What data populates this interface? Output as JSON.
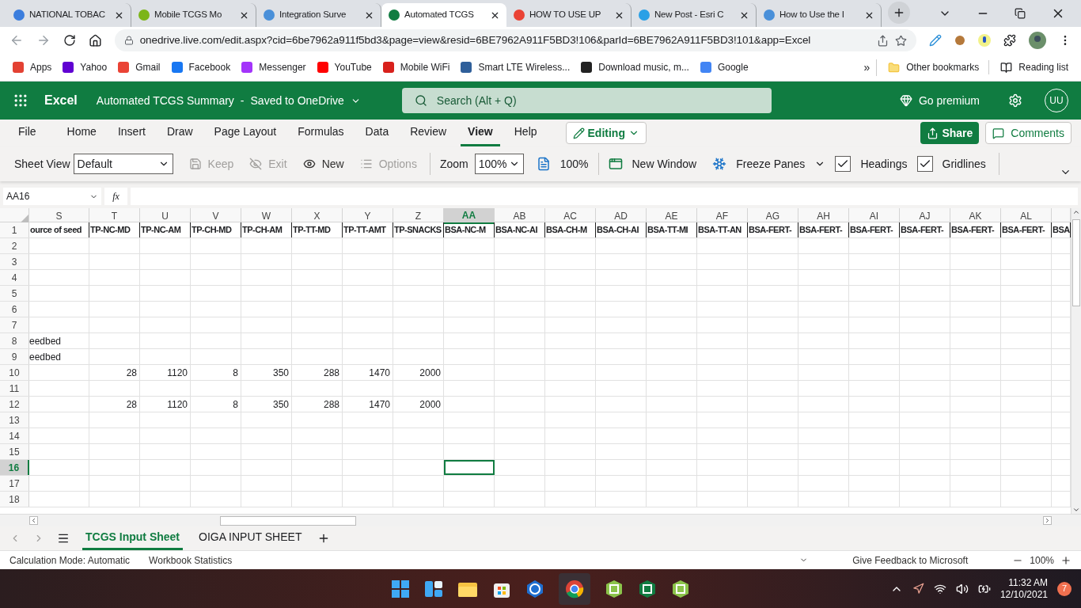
{
  "browser": {
    "tabs": [
      {
        "title": "NATIONAL TOBAC",
        "selected": false
      },
      {
        "title": "Mobile TCGS Mo",
        "selected": false
      },
      {
        "title": "Integration Surve",
        "selected": false
      },
      {
        "title": "Automated TCGS",
        "selected": true
      },
      {
        "title": "HOW TO USE UP",
        "selected": false
      },
      {
        "title": "New Post - Esri C",
        "selected": false
      },
      {
        "title": "How to Use the I",
        "selected": false
      }
    ],
    "url": "onedrive.live.com/edit.aspx?cid=6be7962a911f5bd3&page=view&resid=6BE7962A911F5BD3!106&parId=6BE7962A911F5BD3!101&app=Excel",
    "bookmarks": [
      "Apps",
      "Yahoo",
      "Gmail",
      "Facebook",
      "Messenger",
      "YouTube",
      "Mobile WiFi",
      "Smart LTE Wireless...",
      "Download music, m...",
      "Google"
    ],
    "more": "»",
    "other_bookmarks": "Other bookmarks",
    "reading_list": "Reading list"
  },
  "excel": {
    "app": "Excel",
    "file": "Automated TCGS Summary",
    "dash": "-",
    "saved": "Saved to OneDrive",
    "search_placeholder": "Search (Alt + Q)",
    "premium": "Go premium",
    "avatar": "UU"
  },
  "ribbon": {
    "tabs": [
      {
        "label": "File",
        "selected": false
      },
      {
        "label": "Home",
        "selected": false
      },
      {
        "label": "Insert",
        "selected": false
      },
      {
        "label": "Draw",
        "selected": false
      },
      {
        "label": "Page Layout",
        "selected": false
      },
      {
        "label": "Formulas",
        "selected": false
      },
      {
        "label": "Data",
        "selected": false
      },
      {
        "label": "Review",
        "selected": false
      },
      {
        "label": "View",
        "selected": true
      },
      {
        "label": "Help",
        "selected": false
      }
    ],
    "mode": "Editing",
    "share": "Share",
    "comments": "Comments",
    "sheet_view_label": "Sheet View",
    "sheet_view": "Default",
    "commands": [
      {
        "label": "Keep",
        "disabled": true
      },
      {
        "label": "Exit",
        "disabled": true
      },
      {
        "label": "New",
        "disabled": false
      },
      {
        "label": "Options",
        "disabled": true
      }
    ],
    "zoom_label": "Zoom",
    "zoom": "100%",
    "zoom_100": "100%",
    "new_window": "New Window",
    "freeze_panes": "Freeze Panes",
    "checks": [
      {
        "label": "Headings",
        "checked": true
      },
      {
        "label": "Gridlines",
        "checked": true
      }
    ]
  },
  "formula_bar": {
    "name_box": "AA16",
    "fx": "fx"
  },
  "grid": {
    "columns": [
      {
        "label": "S",
        "selected": false
      },
      {
        "label": "T",
        "selected": false
      },
      {
        "label": "U",
        "selected": false
      },
      {
        "label": "V",
        "selected": false
      },
      {
        "label": "W",
        "selected": false
      },
      {
        "label": "X",
        "selected": false
      },
      {
        "label": "Y",
        "selected": false
      },
      {
        "label": "Z",
        "selected": false
      },
      {
        "label": "AA",
        "selected": true
      },
      {
        "label": "AB",
        "selected": false
      },
      {
        "label": "AC",
        "selected": false
      },
      {
        "label": "AD",
        "selected": false
      },
      {
        "label": "AE",
        "selected": false
      },
      {
        "label": "AF",
        "selected": false
      },
      {
        "label": "AG",
        "selected": false
      },
      {
        "label": "AH",
        "selected": false
      },
      {
        "label": "AI",
        "selected": false
      },
      {
        "label": "AJ",
        "selected": false
      },
      {
        "label": "AK",
        "selected": false
      },
      {
        "label": "AL",
        "selected": false
      }
    ],
    "rows": [
      {
        "label": "1",
        "selected": false,
        "kind": "header",
        "cells": [
          "ource of seed",
          "TP-NC-MD",
          "TP-NC-AM",
          "TP-CH-MD",
          "TP-CH-AM",
          "TP-TT-MD",
          "TP-TT-AMT",
          "TP-SNACKS",
          "BSA-NC-M",
          "BSA-NC-AI",
          "BSA-CH-M",
          "BSA-CH-AI",
          "BSA-TT-MI",
          "BSA-TT-AN",
          "BSA-FERT-",
          "BSA-FERT-",
          "BSA-FERT-",
          "BSA-FERT-",
          "BSA-FERT-",
          "BSA-FERT-",
          "BSA"
        ]
      },
      {
        "label": "2",
        "selected": false
      },
      {
        "label": "3",
        "selected": false
      },
      {
        "label": "4",
        "selected": false
      },
      {
        "label": "5",
        "selected": false
      },
      {
        "label": "6",
        "selected": false
      },
      {
        "label": "7",
        "selected": false
      },
      {
        "label": "8",
        "selected": false,
        "kind": "text",
        "cells": [
          "eedbed"
        ]
      },
      {
        "label": "9",
        "selected": false,
        "kind": "text",
        "cells": [
          "eedbed"
        ]
      },
      {
        "label": "10",
        "selected": false,
        "kind": "numbers",
        "cells": [
          null,
          "28",
          "1120",
          "8",
          "350",
          "288",
          "1470",
          "2000"
        ]
      },
      {
        "label": "11",
        "selected": false
      },
      {
        "label": "12",
        "selected": false,
        "kind": "numbers",
        "cells": [
          null,
          "28",
          "1120",
          "8",
          "350",
          "288",
          "1470",
          "2000"
        ]
      },
      {
        "label": "13",
        "selected": false
      },
      {
        "label": "14",
        "selected": false
      },
      {
        "label": "15",
        "selected": false
      },
      {
        "label": "16",
        "selected": true
      },
      {
        "label": "17",
        "selected": false
      },
      {
        "label": "18",
        "selected": false
      }
    ]
  },
  "sheets": [
    {
      "label": "TCGS Input Sheet",
      "selected": true
    },
    {
      "label": "OIGA INPUT SHEET",
      "selected": false
    }
  ],
  "status_bar": {
    "calc": "Calculation Mode: Automatic",
    "stats": "Workbook Statistics",
    "feedback": "Give Feedback to Microsoft",
    "zoom": "100%"
  },
  "taskbar": {
    "time": "11:32 AM",
    "date": "12/10/2021",
    "notifications": "7"
  }
}
